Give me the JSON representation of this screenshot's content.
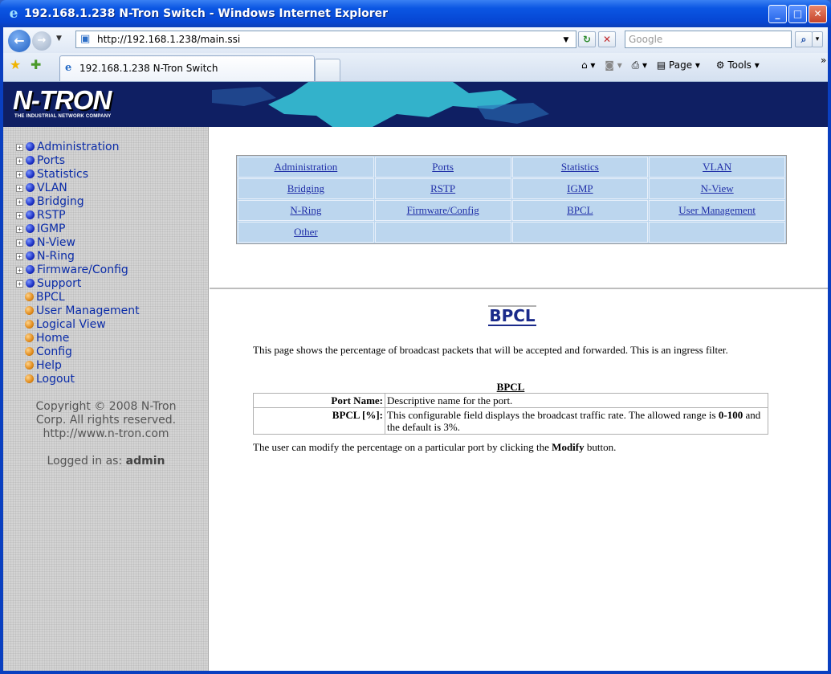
{
  "window": {
    "title": "192.168.1.238 N-Tron Switch - Windows Internet Explorer",
    "controls": {
      "minimize": "_",
      "maximize": "□",
      "close": "✕"
    }
  },
  "address": {
    "url": "http://192.168.1.238/main.ssi",
    "search_placeholder": "Google"
  },
  "tab": {
    "label": "192.168.1.238 N-Tron Switch"
  },
  "commandbar": {
    "page": "Page ▾",
    "tools": "Tools ▾"
  },
  "banner": {
    "logo": "N-TRON",
    "tagline": "THE INDUSTRIAL NETWORK COMPANY"
  },
  "sidebar": {
    "items": [
      {
        "label": "Administration",
        "kind": "folder"
      },
      {
        "label": "Ports",
        "kind": "folder"
      },
      {
        "label": "Statistics",
        "kind": "folder"
      },
      {
        "label": "VLAN",
        "kind": "folder"
      },
      {
        "label": "Bridging",
        "kind": "folder"
      },
      {
        "label": "RSTP",
        "kind": "folder"
      },
      {
        "label": "IGMP",
        "kind": "folder"
      },
      {
        "label": "N-View",
        "kind": "folder"
      },
      {
        "label": "N-Ring",
        "kind": "folder"
      },
      {
        "label": "Firmware/Config",
        "kind": "folder"
      },
      {
        "label": "Support",
        "kind": "folder"
      },
      {
        "label": "BPCL",
        "kind": "page"
      },
      {
        "label": "User Management",
        "kind": "page"
      },
      {
        "label": "Logical View",
        "kind": "page"
      },
      {
        "label": "Home",
        "kind": "page"
      },
      {
        "label": "Config",
        "kind": "page"
      },
      {
        "label": "Help",
        "kind": "page"
      },
      {
        "label": "Logout",
        "kind": "page"
      }
    ],
    "copyright_line1": "Copyright © 2008 N-Tron",
    "copyright_line2": "Corp. All rights reserved.",
    "copyright_line3": "http://www.n-tron.com",
    "logged_in_prefix": "Logged in as: ",
    "logged_in_user": "admin"
  },
  "menu": {
    "rows": [
      [
        "Administration",
        "Ports",
        "Statistics",
        "VLAN"
      ],
      [
        "Bridging",
        "RSTP",
        "IGMP",
        "N-View"
      ],
      [
        "N-Ring",
        "Firmware/Config",
        "BPCL",
        "User Management"
      ],
      [
        "Other",
        "",
        "",
        ""
      ]
    ]
  },
  "content": {
    "title": "BPCL",
    "intro": "This page shows the percentage of broadcast packets that will be accepted and forwarded. This is an ingress filter.",
    "table_caption": "BPCL",
    "definitions": [
      {
        "term": "Port Name:",
        "desc": "Descriptive name for the port."
      },
      {
        "term": "BPCL [%]:",
        "desc_before": "This configurable field displays the broadcast traffic rate. The allowed range is ",
        "desc_bold": "0-100",
        "desc_after": " and the default is 3%."
      }
    ],
    "outro_before": "The user can modify the percentage on a particular port by clicking the ",
    "outro_bold": "Modify",
    "outro_after": " button."
  }
}
